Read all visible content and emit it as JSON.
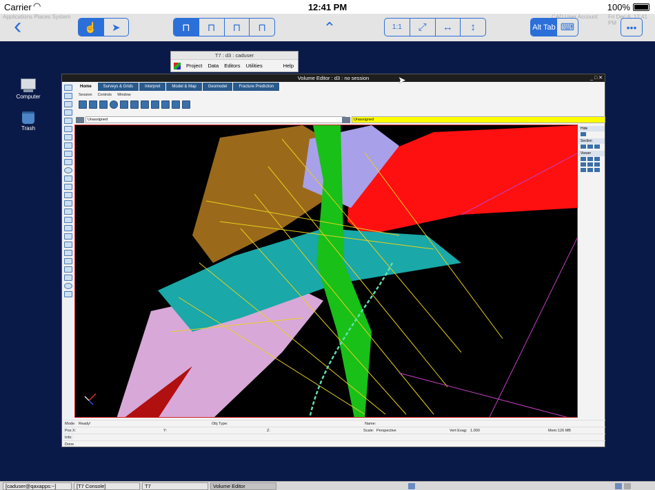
{
  "status_bar": {
    "carrier": "Carrier",
    "time": "12:41 PM",
    "battery": "100%"
  },
  "vnc_toolbar": {
    "alt_tab_label": "Alt Tab",
    "zoom_labels": [
      "1:1"
    ],
    "ghost_left": "Applications  Places  System",
    "ghost_right": "CAD User Account",
    "ghost_date": "Fri Dec  6, 12:41 PM"
  },
  "desktop": {
    "icons": [
      {
        "label": "Computer"
      },
      {
        "label": "Trash"
      }
    ]
  },
  "t7_window": {
    "title": "T7 : d3 : caduser",
    "menu": [
      "Project",
      "Data",
      "Editors",
      "Utilities",
      "Help"
    ]
  },
  "volume_editor": {
    "title": "Volume Editor : d3 : no session",
    "tabs": [
      "Home",
      "Surveys & Grids",
      "Interpret",
      "Model & Map",
      "Geomodel",
      "Fracture Prediction"
    ],
    "active_tab": "Home",
    "menu": [
      "Session",
      "Controls",
      "Window"
    ],
    "selector_left": "Unassigned",
    "selector_right": "Unassigned",
    "right_panel": [
      "Hide",
      "Section",
      "Viewer"
    ],
    "status": {
      "mode_label": "Mode:",
      "mode_value": "Ready!",
      "objtype_label": "Obj Type:",
      "name_label": "Name:",
      "posx_label": "Pos X:",
      "y_label": "Y:",
      "z_label": "Z:",
      "scale_label": "Scale:",
      "scale_value": "Perspective",
      "vexag_label": "Vert Exag:",
      "vexag_value": "1.000",
      "mem_label": "Mem:",
      "mem_value": "126 MB",
      "info_label": "Info:",
      "done_label": "Done"
    }
  },
  "taskbar": {
    "items": [
      "[caduser@qaxapps:~]",
      "[T7 Console]",
      "T7",
      "Volume Editor"
    ]
  },
  "colors": {
    "accent": "#2b6fd9",
    "desktop": "#0a1a48",
    "selection": "#ffff00"
  }
}
